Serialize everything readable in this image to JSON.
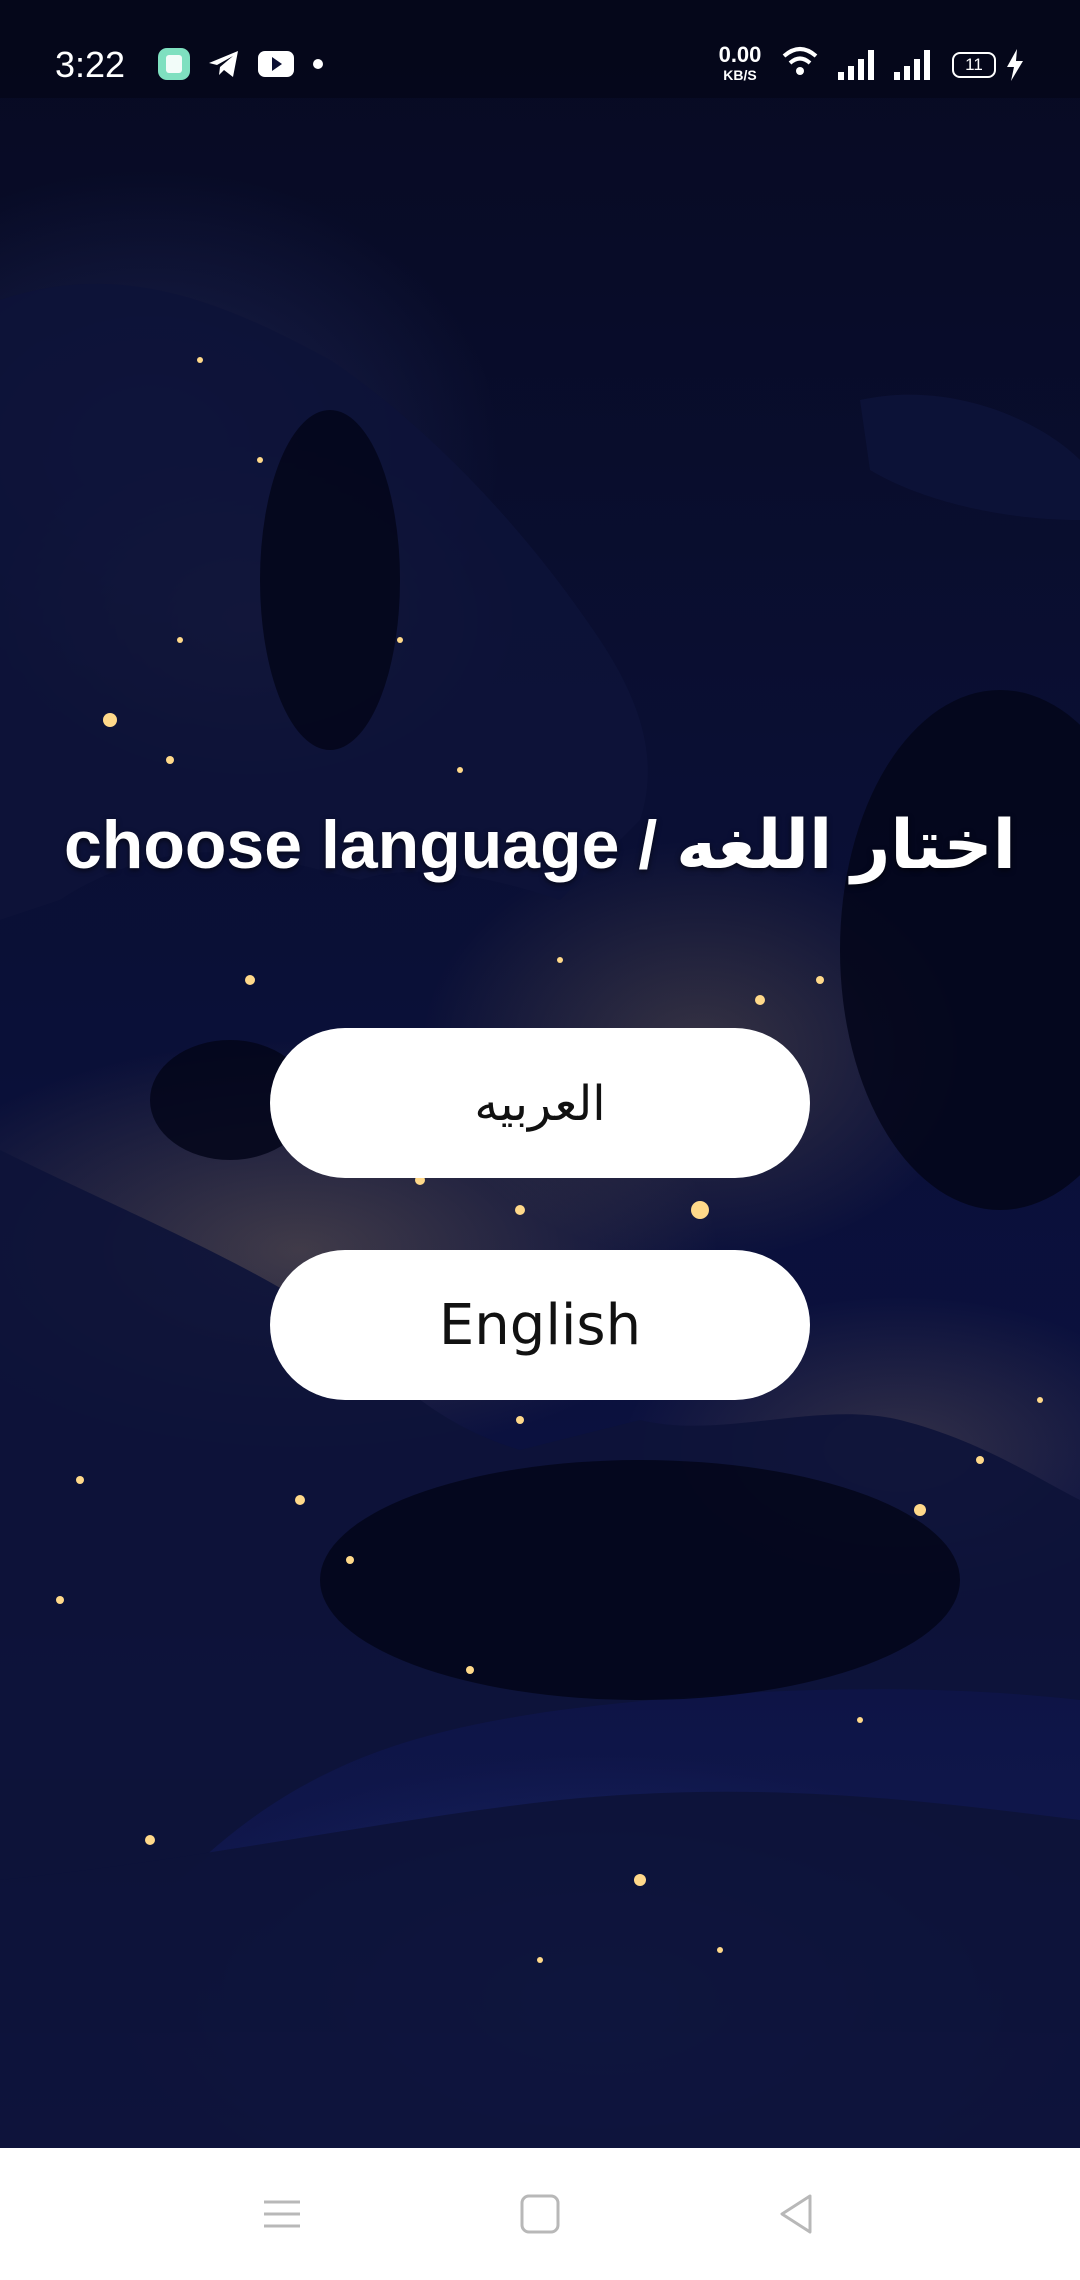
{
  "status_bar": {
    "time": "3:22",
    "net_speed_value": "0.00",
    "net_speed_unit": "KB/S",
    "battery_level": "11",
    "icons": [
      "app-notification-icon",
      "telegram-icon",
      "youtube-icon",
      "more-notifications-dot-icon",
      "wifi-icon",
      "signal-icon",
      "signal-icon",
      "battery-icon",
      "charging-icon"
    ]
  },
  "main": {
    "headline": "choose language / اختار اللغه",
    "buttons": {
      "arabic": "العربيه",
      "english": "English"
    }
  },
  "nav_bar": {
    "icons": [
      "menu-icon",
      "home-icon",
      "back-icon"
    ]
  },
  "colors": {
    "button_bg": "#ffffff",
    "headline_text": "#ffffff",
    "button_text": "#111111",
    "background": "#07091d"
  }
}
